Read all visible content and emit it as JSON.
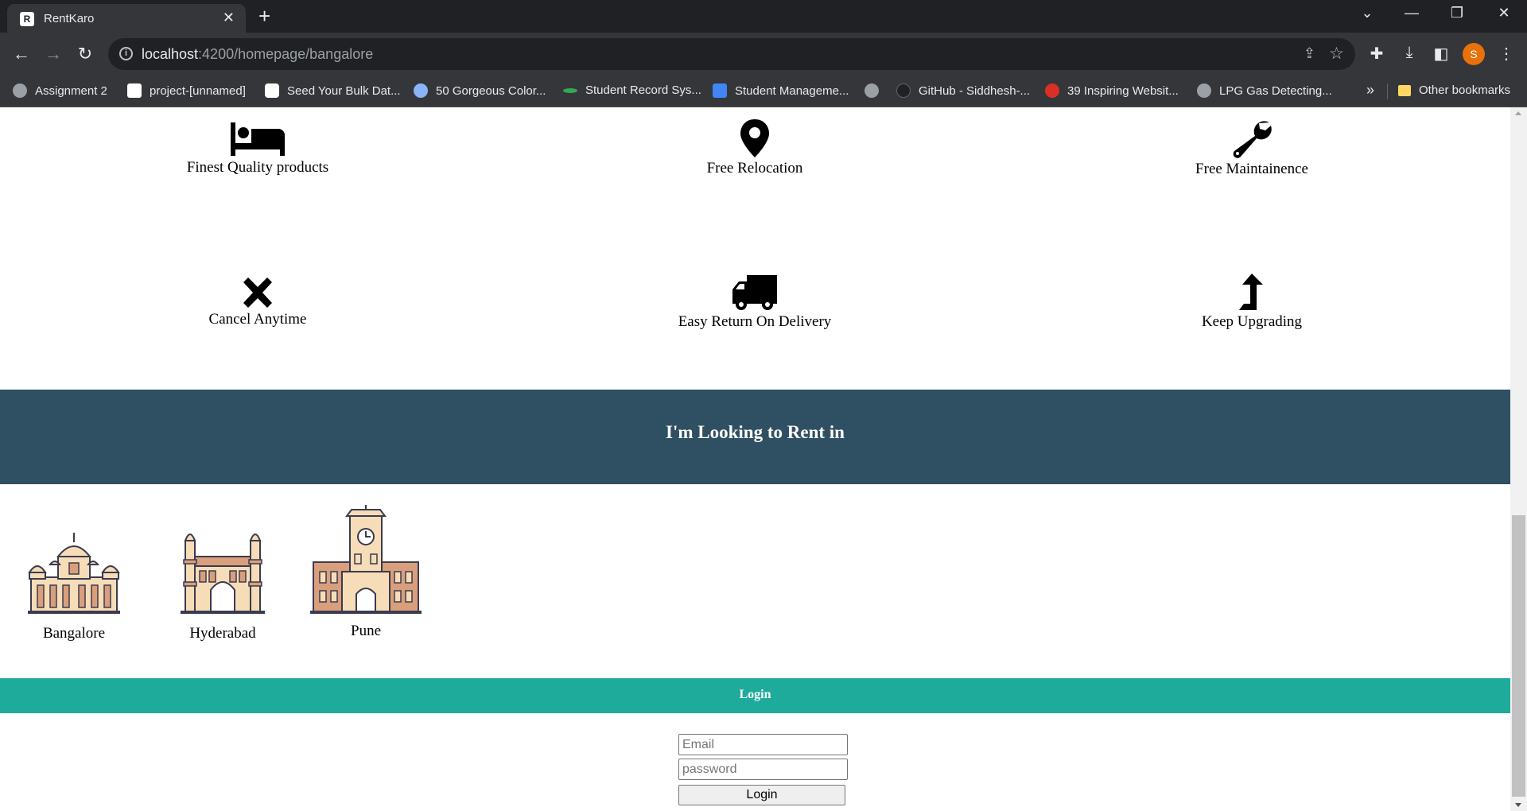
{
  "browser": {
    "tab_title": "RentKaro",
    "tab_favicon": "R",
    "url_host": "localhost",
    "url_path": ":4200/homepage/bangalore",
    "avatar_letter": "S",
    "bookmarks": [
      {
        "label": "Assignment 2",
        "icon": "globe-icon",
        "color": "#9aa0a6"
      },
      {
        "label": "project-[unnamed]",
        "icon": "notion-icon",
        "color": "#ffffff"
      },
      {
        "label": "Seed Your Bulk Dat...",
        "icon": "seed-icon",
        "color": "#ffffff"
      },
      {
        "label": "50 Gorgeous Color...",
        "icon": "palette-icon",
        "color": "#8ab4f8"
      },
      {
        "label": "Student Record Sys...",
        "icon": "record-icon",
        "color": "#34a853"
      },
      {
        "label": "Student Manageme...",
        "icon": "grid-icon",
        "color": "#4285f4"
      },
      {
        "label": "",
        "icon": "globe-icon",
        "color": "#9aa0a6"
      },
      {
        "label": "GitHub - Siddhesh-...",
        "icon": "github-icon",
        "color": "#202124"
      },
      {
        "label": "39 Inspiring Websit...",
        "icon": "inspire-icon",
        "color": "#d93025"
      },
      {
        "label": "LPG Gas Detecting...",
        "icon": "globe-icon",
        "color": "#9aa0a6"
      }
    ],
    "other_bookmarks": "Other bookmarks"
  },
  "features": [
    {
      "label": "Finest Quality products",
      "icon": "bed-icon"
    },
    {
      "label": "Free Relocation",
      "icon": "map-marker-icon"
    },
    {
      "label": "Free Maintainence",
      "icon": "wrench-icon"
    },
    {
      "label": "Cancel Anytime",
      "icon": "close-x-icon"
    },
    {
      "label": "Easy Return On Delivery",
      "icon": "truck-icon"
    },
    {
      "label": "Keep Upgrading",
      "icon": "level-up-arrow-icon"
    }
  ],
  "rent_section": {
    "title": "I'm Looking to Rent in",
    "cities": [
      {
        "name": "Bangalore",
        "icon": "vidhana-soudha-icon"
      },
      {
        "name": "Hyderabad",
        "icon": "charminar-icon"
      },
      {
        "name": "Pune",
        "icon": "pune-clock-tower-icon"
      }
    ]
  },
  "login": {
    "bar_title": "Login",
    "email_placeholder": "Email",
    "password_placeholder": "password",
    "button_label": "Login"
  },
  "colors": {
    "rent_banner": "#2f5062",
    "login_bar": "#1fab9b",
    "building_fill": "#f6ddb8",
    "building_accent": "#d99f7c",
    "building_outline": "#3b3b4f"
  }
}
